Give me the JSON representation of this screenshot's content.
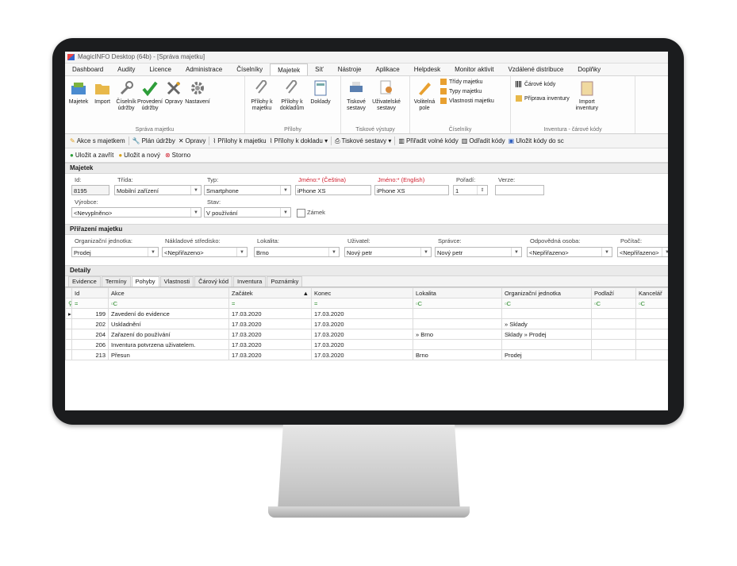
{
  "window": {
    "title": "MagicINFO Desktop (64b) - [Správa majetku]"
  },
  "menu": [
    "Dashboard",
    "Audity",
    "Licence",
    "Administrace",
    "Číselníky",
    "Majetek",
    "Síť",
    "Nástroje",
    "Aplikace",
    "Helpdesk",
    "Monitor aktivit",
    "Vzdálené distribuce",
    "Doplňky"
  ],
  "ribbon": {
    "sprava": {
      "buttons": [
        "Majetek",
        "Import",
        "Číselník údržby",
        "Provedení údržby",
        "Opravy",
        "Nastavení"
      ],
      "group": "Správa majetku"
    },
    "prilohy": {
      "buttons": [
        "Přílohy k majetku",
        "Přílohy k dokladům",
        "Doklady"
      ],
      "group": "Přílohy"
    },
    "tisk": {
      "buttons": [
        "Tiskové sestavy",
        "Uživatelské sestavy"
      ],
      "group": "Tiskové výstupy"
    },
    "ciselniky": {
      "button": "Volitelná pole",
      "items": [
        "Třídy majetku",
        "Typy majetku",
        "Vlastnosti majetku"
      ],
      "group": "Číselníky"
    },
    "inventura": {
      "items": [
        "Čárové kódy",
        "Příprava inventury"
      ],
      "button": "Import inventury",
      "group": "Inventura - čárové kódy"
    }
  },
  "toolbar1": [
    "Akce s majetkem",
    "Plán údržby",
    "Opravy",
    "Přílohy k majetku",
    "Přílohy k dokladu ▾",
    "Tiskové sestavy ▾",
    "Přiřadit volné kódy",
    "Odřadit kódy",
    "Uložit kódy do sc"
  ],
  "toolbar2": [
    "Uložit a zavřít",
    "Uložit a nový",
    "Storno"
  ],
  "majetek": {
    "header": "Majetek",
    "labels": {
      "id": "Id:",
      "trida": "Třída:",
      "typ": "Typ:",
      "jmeno_cs": "Jméno:* (Čeština)",
      "jmeno_en": "Jméno:* (English)",
      "poradi": "Pořadí:",
      "verze": "Verze:",
      "vyrobce": "Výrobce:",
      "stav": "Stav:",
      "zamek": "Zámek"
    },
    "values": {
      "id": "8195",
      "trida": "Mobilní zařízení",
      "typ": "Smartphone",
      "jmeno_cs": "iPhone XS",
      "jmeno_en": "iPhone XS",
      "poradi": "1",
      "verze": "",
      "vyrobce": "<Nevyplněno>",
      "stav": "V používání"
    }
  },
  "prirazeni": {
    "header": "Přiřazení majetku",
    "fields": [
      {
        "label": "Organizační jednotka:",
        "value": "Prodej"
      },
      {
        "label": "Nákladové středisko:",
        "value": "<Nepřiřazeno>"
      },
      {
        "label": "Lokalita:",
        "value": "Brno"
      },
      {
        "label": "Uživatel:",
        "value": "Nový petr"
      },
      {
        "label": "Správce:",
        "value": "Nový petr"
      },
      {
        "label": "Odpovědná osoba:",
        "value": "<Nepřiřazeno>"
      },
      {
        "label": "Počítač:",
        "value": "<Nepřiřazeno>"
      }
    ]
  },
  "detaily": {
    "header": "Detaily",
    "tabs": [
      "Evidence",
      "Termíny",
      "Pohyby",
      "Vlastnosti",
      "Čárový kód",
      "Inventura",
      "Poznámky"
    ],
    "active_tab": "Pohyby",
    "columns": [
      "Id",
      "Akce",
      "Začátek",
      "Konec",
      "Lokalita",
      "Organizační jednotka",
      "Podlaží",
      "Kancelář"
    ],
    "rows": [
      {
        "id": "199",
        "akce": "Zavedení do evidence",
        "zacatek": "17.03.2020",
        "konec": "17.03.2020",
        "lokalita": "",
        "org": "",
        "podlazi": "",
        "kancelar": ""
      },
      {
        "id": "202",
        "akce": "Uskladnění",
        "zacatek": "17.03.2020",
        "konec": "17.03.2020",
        "lokalita": "",
        "org": "» Sklady",
        "podlazi": "",
        "kancelar": ""
      },
      {
        "id": "204",
        "akce": "Zařazení do používání",
        "zacatek": "17.03.2020",
        "konec": "17.03.2020",
        "lokalita": "» Brno",
        "org": "Sklady » Prodej",
        "podlazi": "",
        "kancelar": ""
      },
      {
        "id": "206",
        "akce": "Inventura potvrzena uživatelem.",
        "zacatek": "17.03.2020",
        "konec": "17.03.2020",
        "lokalita": "",
        "org": "",
        "podlazi": "",
        "kancelar": ""
      },
      {
        "id": "213",
        "akce": "Přesun",
        "zacatek": "17.03.2020",
        "konec": "17.03.2020",
        "lokalita": "Brno",
        "org": "Prodej",
        "podlazi": "",
        "kancelar": ""
      }
    ]
  },
  "colors": {
    "accent_green": "#2e9e3a",
    "required_red": "#d0202f",
    "monitor": "#1b1c1e"
  }
}
